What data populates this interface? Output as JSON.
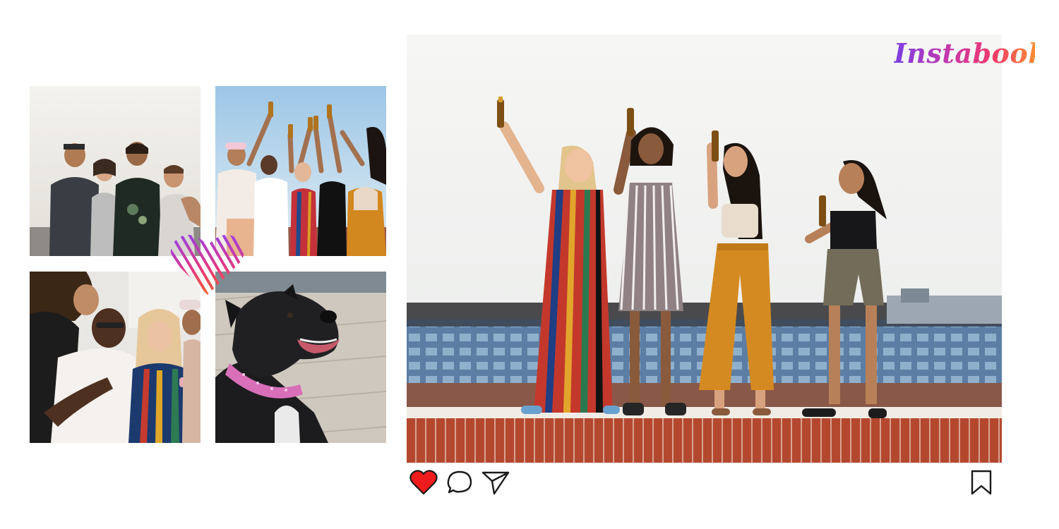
{
  "brand": {
    "name": "Instabook",
    "gradient": [
      "#7b3fe4",
      "#c837ab",
      "#f0386b",
      "#fd8d32"
    ]
  },
  "collage": {
    "tiles": [
      {
        "subject": "group-of-friends-laughing-photo"
      },
      {
        "subject": "friends-raising-bottles-photo"
      },
      {
        "subject": "friends-celebrating-with-cake-photo"
      },
      {
        "subject": "black-dog-with-pink-collar-photo"
      }
    ],
    "sticker": {
      "icon": "heart-sticker-icon",
      "gradient": [
        "#8a3ffc",
        "#e5397d",
        "#f76b1c"
      ]
    }
  },
  "post": {
    "photo": {
      "subject": "four-women-toasting-on-rooftop-photo"
    },
    "actions": {
      "like": {
        "icon": "heart-icon",
        "state": "liked",
        "color": "#ee1c1c"
      },
      "comment": {
        "icon": "speech-bubble-icon"
      },
      "share": {
        "icon": "paper-plane-icon"
      },
      "save": {
        "icon": "bookmark-icon"
      }
    }
  }
}
